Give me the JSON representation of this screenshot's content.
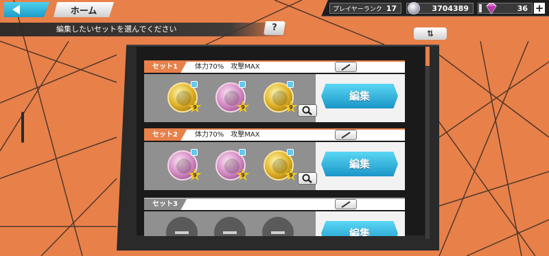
{
  "header": {
    "home_label": "ホーム",
    "rank_label": "プレイヤーランク",
    "rank_value": "17",
    "coins": "3704389",
    "gems": "36",
    "plus_label": "+"
  },
  "instruction": "編集したいセットを選んでください",
  "help_label": "?",
  "sort_label": "⇅",
  "colors": {
    "accent_orange": "#e8804a",
    "edit_blue": "#2ab0dc",
    "panel_dark": "#2a2a2a"
  },
  "sets": [
    {
      "tag": "セット1",
      "description": "体力70%　攻撃MAX",
      "edit_label": "編集",
      "medals": [
        {
          "type": "gold",
          "level": "9"
        },
        {
          "type": "pink",
          "level": "9"
        },
        {
          "type": "gold",
          "level": "9"
        }
      ]
    },
    {
      "tag": "セット2",
      "description": "体力70%　攻撃MAX",
      "edit_label": "編集",
      "medals": [
        {
          "type": "pink",
          "level": "9"
        },
        {
          "type": "pink",
          "level": "9"
        },
        {
          "type": "gold",
          "level": "9"
        }
      ]
    },
    {
      "tag": "セット3",
      "description": "",
      "edit_label": "編集",
      "medals": []
    }
  ]
}
